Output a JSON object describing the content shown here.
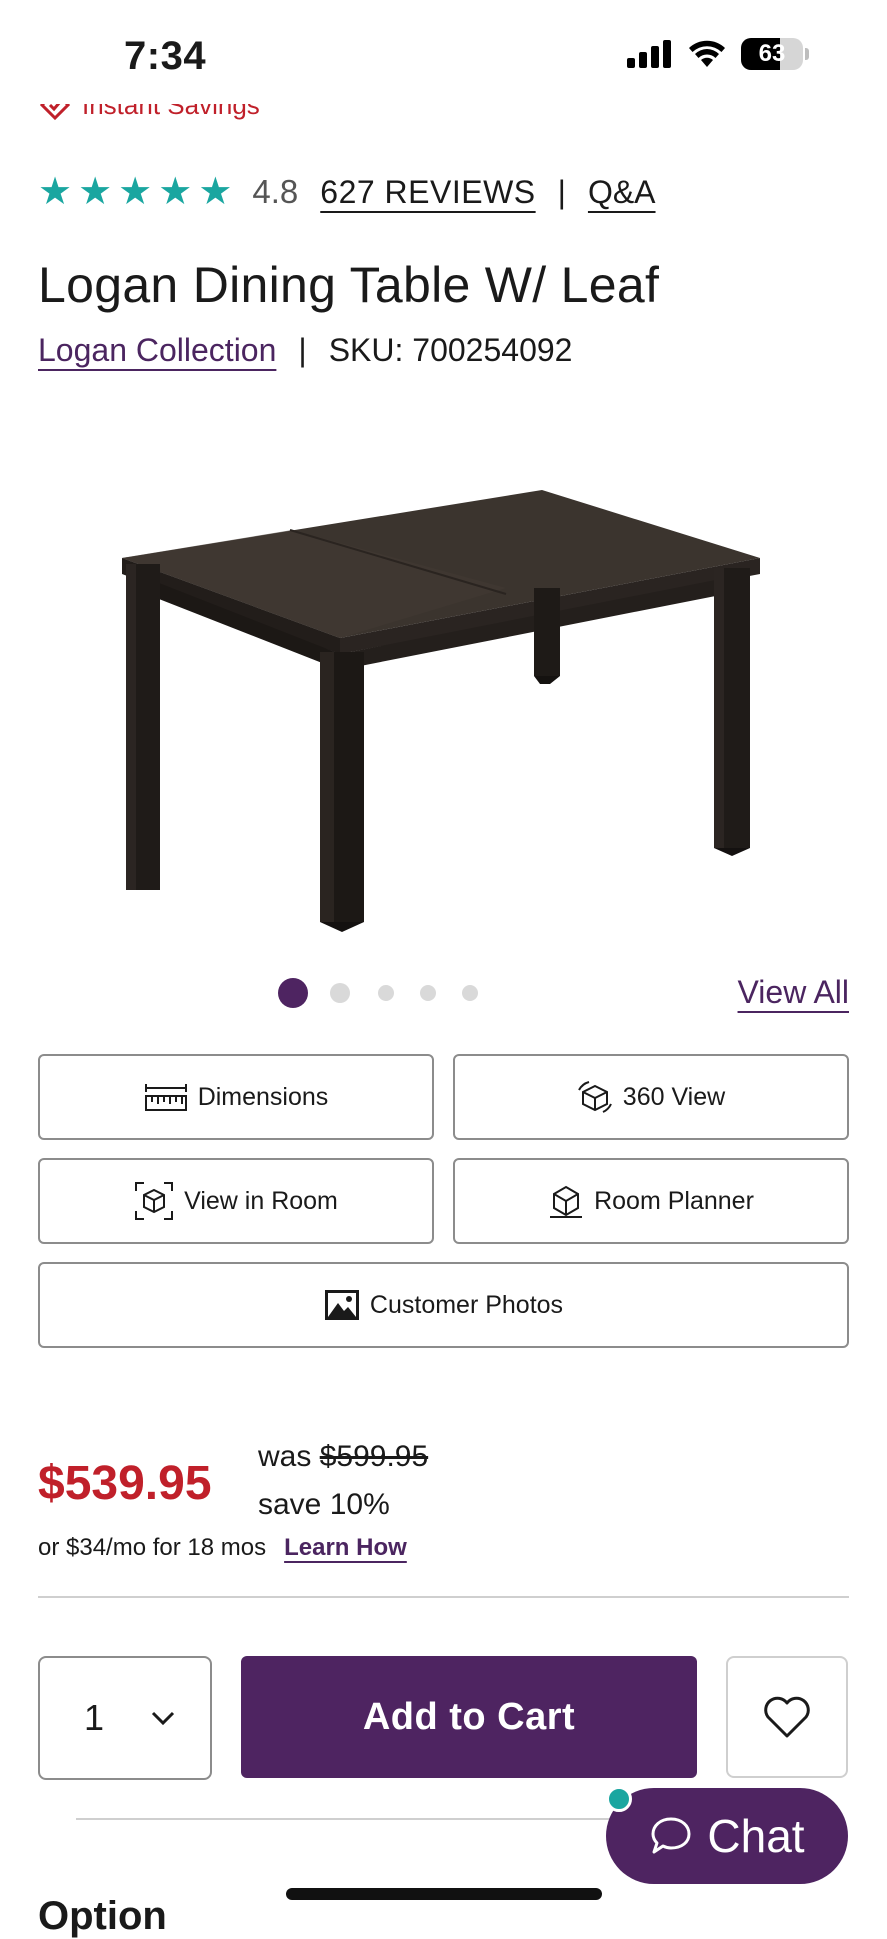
{
  "status_bar": {
    "time": "7:34",
    "battery": "63",
    "battery_level": 0.63
  },
  "promo": {
    "savings_label": "Instant Savings"
  },
  "rating": {
    "value": "4.8",
    "stars": 5,
    "reviews_label": "627 REVIEWS",
    "separator": "|",
    "qa_label": "Q&A"
  },
  "product": {
    "title": "Logan Dining Table W/ Leaf",
    "collection_label": "Logan Collection",
    "separator": "|",
    "sku": "SKU: 700254092"
  },
  "gallery": {
    "view_all_label": "View All",
    "slide_count": 5,
    "active_slide": 1
  },
  "actions": {
    "dimensions_label": "Dimensions",
    "view360_label": "360 View",
    "view_in_room_label": "View in Room",
    "room_planner_label": "Room Planner",
    "customer_photos_label": "Customer Photos"
  },
  "pricing": {
    "price": "$539.95",
    "was_prefix": "was",
    "was_price": "$599.95",
    "save": "save 10%",
    "finance_text": "or $34/mo for 18 mos",
    "learn_how_label": "Learn How"
  },
  "cart": {
    "quantity": "1",
    "add_to_cart_label": "Add to Cart"
  },
  "chat": {
    "label": "Chat"
  },
  "section": {
    "option_heading": "Option"
  },
  "colors": {
    "brand_purple": "#4e2461",
    "sale_red": "#c0202a",
    "star_teal": "#1aa6a0"
  }
}
